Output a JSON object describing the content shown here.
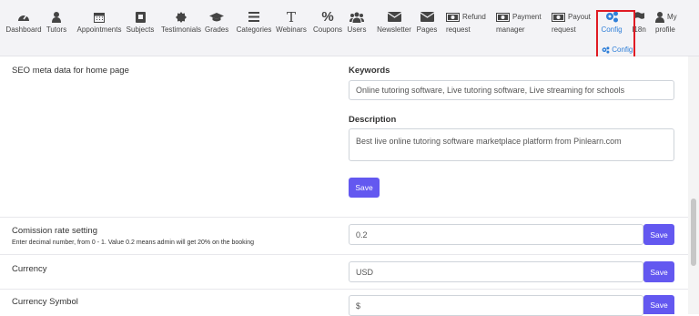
{
  "nav": {
    "items": [
      {
        "name": "dashboard",
        "icon": "dashboard-icon",
        "label": "Dashboard"
      },
      {
        "name": "tutors",
        "icon": "user-icon",
        "label": "Tutors"
      },
      {
        "name": "appointments",
        "icon": "calendar-icon",
        "label": "Appointments"
      },
      {
        "name": "subjects",
        "icon": "book-icon",
        "label": "Subjects"
      },
      {
        "name": "testimonials",
        "icon": "badge-icon",
        "label": "Testimonials"
      },
      {
        "name": "grades",
        "icon": "graduation-cap-icon",
        "label": "Grades"
      },
      {
        "name": "categories",
        "icon": "list-icon",
        "label": "Categories"
      },
      {
        "name": "webinars",
        "icon": "text-icon",
        "label": "Webinars"
      },
      {
        "name": "coupons",
        "icon": "percent-icon",
        "label": "Coupons"
      },
      {
        "name": "users",
        "icon": "users-icon",
        "label": "Users"
      },
      {
        "name": "newsletter",
        "icon": "envelope-icon",
        "label": "Newsletter"
      },
      {
        "name": "pages",
        "icon": "envelope-icon",
        "label": "Pages"
      }
    ],
    "money_items": [
      {
        "name": "refund-request",
        "icon": "money-icon",
        "line1": "Refund",
        "line2": "request"
      },
      {
        "name": "payment-manager",
        "icon": "money-icon",
        "line1": "Payment",
        "line2": "manager"
      },
      {
        "name": "payout-request",
        "icon": "money-icon",
        "line1": "Payout",
        "line2": "request"
      }
    ],
    "config": {
      "icon": "gears-icon",
      "label": "Config"
    },
    "i18n": {
      "icon": "flag-icon",
      "label": "I18n"
    },
    "profile": {
      "icon": "user-icon",
      "line1": "My",
      "line2": "profile"
    },
    "config_menu_item": {
      "icon": "gears-icon",
      "label": "Config"
    },
    "accent_color": "#2f7fd8",
    "highlight_color": "#e01b24"
  },
  "seo": {
    "section_label": "SEO meta data for home page",
    "keywords_title": "Keywords",
    "keywords_value": "Online tutoring software, Live tutoring software, Live streaming for schools",
    "description_title": "Description",
    "description_value": "Best live online tutoring software marketplace platform from Pinlearn.com",
    "save_label": "Save"
  },
  "commission": {
    "label": "Comission rate setting",
    "help": "Enter decimal number, from 0 - 1. Value 0.2 means admin will get 20% on the booking",
    "value": "0.2",
    "save_label": "Save"
  },
  "currency": {
    "label": "Currency",
    "value": "USD",
    "save_label": "Save"
  },
  "currency_symbol": {
    "label": "Currency Symbol",
    "value": "$",
    "save_label": "Save"
  },
  "button_color": "#6358f0"
}
